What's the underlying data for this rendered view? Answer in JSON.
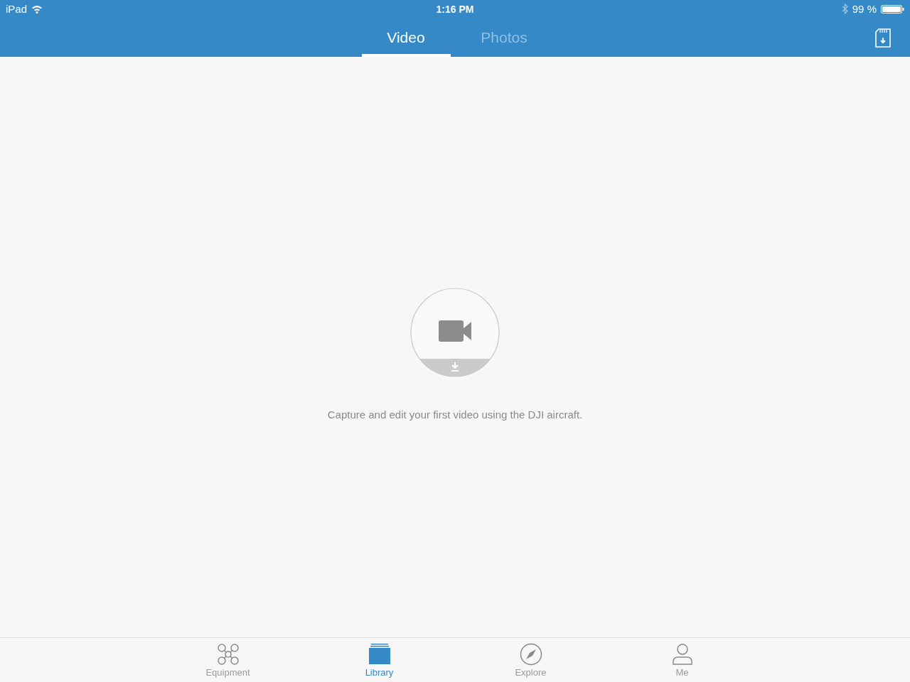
{
  "status_bar": {
    "device": "iPad",
    "time": "1:16 PM",
    "battery": "99 %"
  },
  "tabs": [
    {
      "label": "Video",
      "selected": true
    },
    {
      "label": "Photos",
      "selected": false
    }
  ],
  "empty_state": {
    "message": "Capture and edit your first video using the DJI aircraft."
  },
  "tab_bar": [
    {
      "label": "Equipment",
      "kind": "drone",
      "selected": false
    },
    {
      "label": "Library",
      "kind": "library",
      "selected": true
    },
    {
      "label": "Explore",
      "kind": "compass",
      "selected": false
    },
    {
      "label": "Me",
      "kind": "person",
      "selected": false
    }
  ]
}
